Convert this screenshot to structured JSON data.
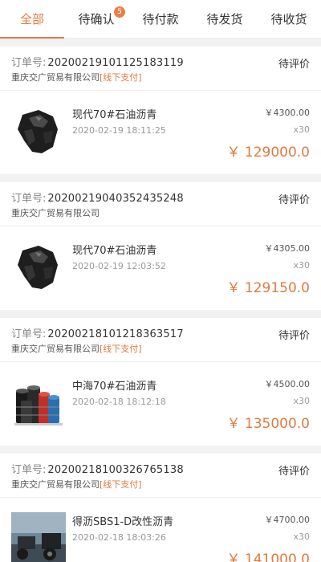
{
  "tabs": [
    {
      "label": "全部",
      "active": true
    },
    {
      "label": "待确认",
      "badge": "5"
    },
    {
      "label": "待付款"
    },
    {
      "label": "待发货"
    },
    {
      "label": "待收货"
    }
  ],
  "orders": [
    {
      "order_no_label": "订单号:",
      "order_no": "20200219101125183119",
      "status": "待评价",
      "company": "重庆交广贸易有限公司",
      "pay_tag": "[线下支付]",
      "product_name": "现代70#石油沥青",
      "time": "2020-02-19 18:11:25",
      "unit_price": "￥4300.00",
      "quantity": "x30",
      "total": "￥ 129000.0",
      "thumb_icon": "asphalt-rock-icon"
    },
    {
      "order_no_label": "订单号:",
      "order_no": "20200219040352435248",
      "status": "待评价",
      "company": "重庆交广贸易有限公司",
      "pay_tag": "",
      "product_name": "现代70#石油沥青",
      "time": "2020-02-19 12:03:52",
      "unit_price": "￥4305.00",
      "quantity": "x30",
      "total": "￥ 129150.0",
      "thumb_icon": "asphalt-rock-icon"
    },
    {
      "order_no_label": "订单号:",
      "order_no": "20200218101218363517",
      "status": "待评价",
      "company": "重庆交广贸易有限公司",
      "pay_tag": "[线下支付]",
      "product_name": "中海70#石油沥青",
      "time": "2020-02-18 18:12:18",
      "unit_price": "￥4500.00",
      "quantity": "x30",
      "total": "￥ 135000.0",
      "thumb_icon": "barrels-icon"
    },
    {
      "order_no_label": "订单号:",
      "order_no": "20200218100326765138",
      "status": "待评价",
      "company": "重庆交广贸易有限公司",
      "pay_tag": "[线下支付]",
      "product_name": "得沥SBS1-D改性沥青",
      "time": "2020-02-18 18:03:26",
      "unit_price": "￥4700.00",
      "quantity": "x30",
      "total": "￥ 141000.0",
      "thumb_icon": "machinery-photo-icon"
    }
  ],
  "colors": {
    "accent": "#e07a3f"
  }
}
